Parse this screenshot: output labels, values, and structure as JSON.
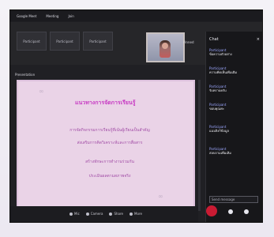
{
  "titlebar": {
    "tabs": [
      "Google Meet",
      "Meeting",
      "Join"
    ]
  },
  "thumbnails": [
    {
      "label": "Participant"
    },
    {
      "label": "Participant"
    },
    {
      "label": "Participant"
    }
  ],
  "video": {
    "label": "Pinned"
  },
  "left_header": {
    "text": "Presentation"
  },
  "slide": {
    "title": "แนวทางการจัดการเรียนรู้",
    "lines": [
      "การจัดกิจกรรมการเรียนรู้ที่เน้นผู้เรียนเป็นสำคัญ",
      "ส่งเสริมการคิดวิเคราะห์และการสื่อสาร",
      "สร้างทักษะการทำงานร่วมกัน",
      "ประเมินผลตามสภาพจริง"
    ]
  },
  "chat": {
    "header": "Chat",
    "items": [
      {
        "user": "Participant",
        "msg": "ข้อความตัวอย่าง"
      },
      {
        "user": "Participant",
        "msg": "ความคิดเห็นเพิ่มเติม"
      },
      {
        "user": "Participant",
        "msg": "รับทราบครับ"
      },
      {
        "user": "Participant",
        "msg": "ขอบคุณค่ะ"
      },
      {
        "user": "Participant",
        "msg": "แนบลิงก์ข้อมูล"
      },
      {
        "user": "Participant",
        "msg": "สอบถามเพิ่มเติม"
      }
    ],
    "input_placeholder": "Send message"
  },
  "controls": {
    "items": [
      "Mic",
      "Camera",
      "Share",
      "More"
    ]
  },
  "colors": {
    "slide_bg": "#ead3e7",
    "slide_title": "#c73ac3",
    "slide_text": "#a14ca6",
    "mic": "#c91b33"
  }
}
